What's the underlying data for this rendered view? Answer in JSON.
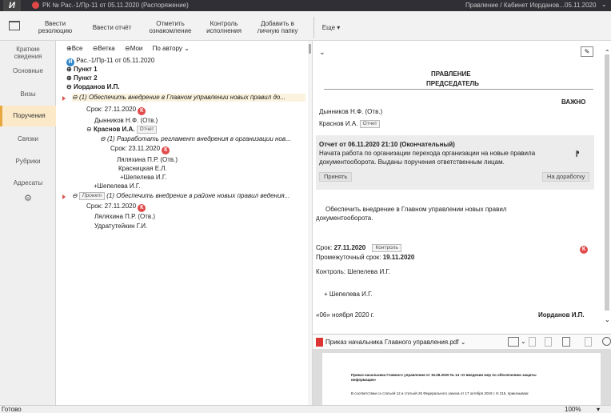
{
  "titlebar": {
    "title": "РК № Рас.-1/Пр-11 от 05.11.2020 (Распоряжение)",
    "right_title": "Правление / Кабинет Иорданов...",
    "date": "05.11.2020",
    "logo": "И"
  },
  "toolbar": {
    "buttons": [
      {
        "label1": "Ввести",
        "label2": "резолюцию"
      },
      {
        "label1": "Ввести отчёт",
        "label2": ""
      },
      {
        "label1": "Отметить",
        "label2": "ознакомление"
      },
      {
        "label1": "Контроль",
        "label2": "исполнения"
      },
      {
        "label1": "Добавить в",
        "label2": "личную папку"
      },
      {
        "label1": "Еще ▾",
        "label2": ""
      }
    ]
  },
  "leftnav": {
    "items": [
      {
        "label1": "Краткие",
        "label2": "сведения"
      },
      {
        "label1": "Основные",
        "label2": ""
      },
      {
        "label1": "Визы",
        "label2": ""
      },
      {
        "label1": "Поручения",
        "label2": ""
      },
      {
        "label1": "Связки",
        "label2": ""
      },
      {
        "label1": "Рубрики",
        "label2": ""
      },
      {
        "label1": "Адресаты",
        "label2": ""
      }
    ],
    "gear": "⚙"
  },
  "tree": {
    "filters": {
      "all": "⊕Все",
      "branch": "⊖Ветка",
      "mine": "⊖Мои",
      "by_author": "По автору ⌄"
    },
    "doc": "Рас.-1/Пр-11 от 05.11.2020",
    "p1": "Пункт 1",
    "p2": "Пункт 2",
    "author": "Иорданов И.П.",
    "r1_text": "(1) Обеспечить внедрение в Главном управлении новых правил до...",
    "r1_due": "Срок: 27.11.2020",
    "r1_exec": "Дынников Н.Ф. (Отв.)",
    "r2_name": "Краснов И.А.",
    "r2_tag": "Отчет",
    "r3_text": "(1) Разработать регламент внедрения в организации нов...",
    "r3_due": "Срок: 23.11.2020",
    "r3_exec1": "Ляляхина П.Р. (Отв.)",
    "r3_exec2": "Красницкая Е.Л.",
    "r3_exec3": "+Шепелева И.Г.",
    "r4": "+Шепелева И.Г.",
    "r5_tag": "Проект",
    "r5_text": "(1) Обеспечить внедрение в районе новых правил ведения...",
    "r5_due": "Срок: 27.11.2020",
    "r5_exec1": "Ляляхина П.Р. (Отв.)",
    "r5_exec2": "Удратутейкин Г.И."
  },
  "detail": {
    "org": "ПРАВЛЕНИЕ",
    "chair": "ПРЕДСЕДАТЕЛЬ",
    "urgent": "ВАЖНО",
    "exec1": "Дынников Н.Ф. (Отв.)",
    "exec2": "Краснов И.А.",
    "exec2_tag": "Отчет",
    "report_title": "Отчет от 06.11.2020 21:10 (Окончательный)",
    "report_line1": "Начата работа по организации перехода организации на новые правила",
    "report_line2": "документооборота. Выданы поручения ответственным лицам.",
    "accept": "Принять",
    "rework": "На доработку",
    "body1": "Обеспечить внедрение в Главном управлении новых правил",
    "body2": "документооборота.",
    "due_label": "Срок:",
    "due_value": "27.11.2020",
    "control_btn": "Контроль",
    "interim_label": "Промежуточный срок:",
    "interim_value": "19.11.2020",
    "controller": "Контроль: Шепелева И.Г.",
    "co_exec": "+ Шепелева И.Г.",
    "date": "«06» ноября 2020 г.",
    "signer": "Иорданов И.П."
  },
  "attachment": {
    "name": "Приказ начальника Главного управления.pdf ⌄",
    "pdf_line1": "Приказ начальника Главного управления от 15.08.2020 № 14 «О введении мер по обеспечению защиты",
    "pdf_line2": "информации»",
    "pdf_line3": "В соответствии со статьей 12 и статьей 26 Федерального закона от 17 октября 2019 г. N 215, приказываю:"
  },
  "status": {
    "left": "Готово",
    "zoom": "100%"
  },
  "colors": {
    "accent": "#e8a840",
    "red_badge": "#e04a4a",
    "blue_badge": "#2e86c9",
    "titlebar": "#2f2f35"
  }
}
